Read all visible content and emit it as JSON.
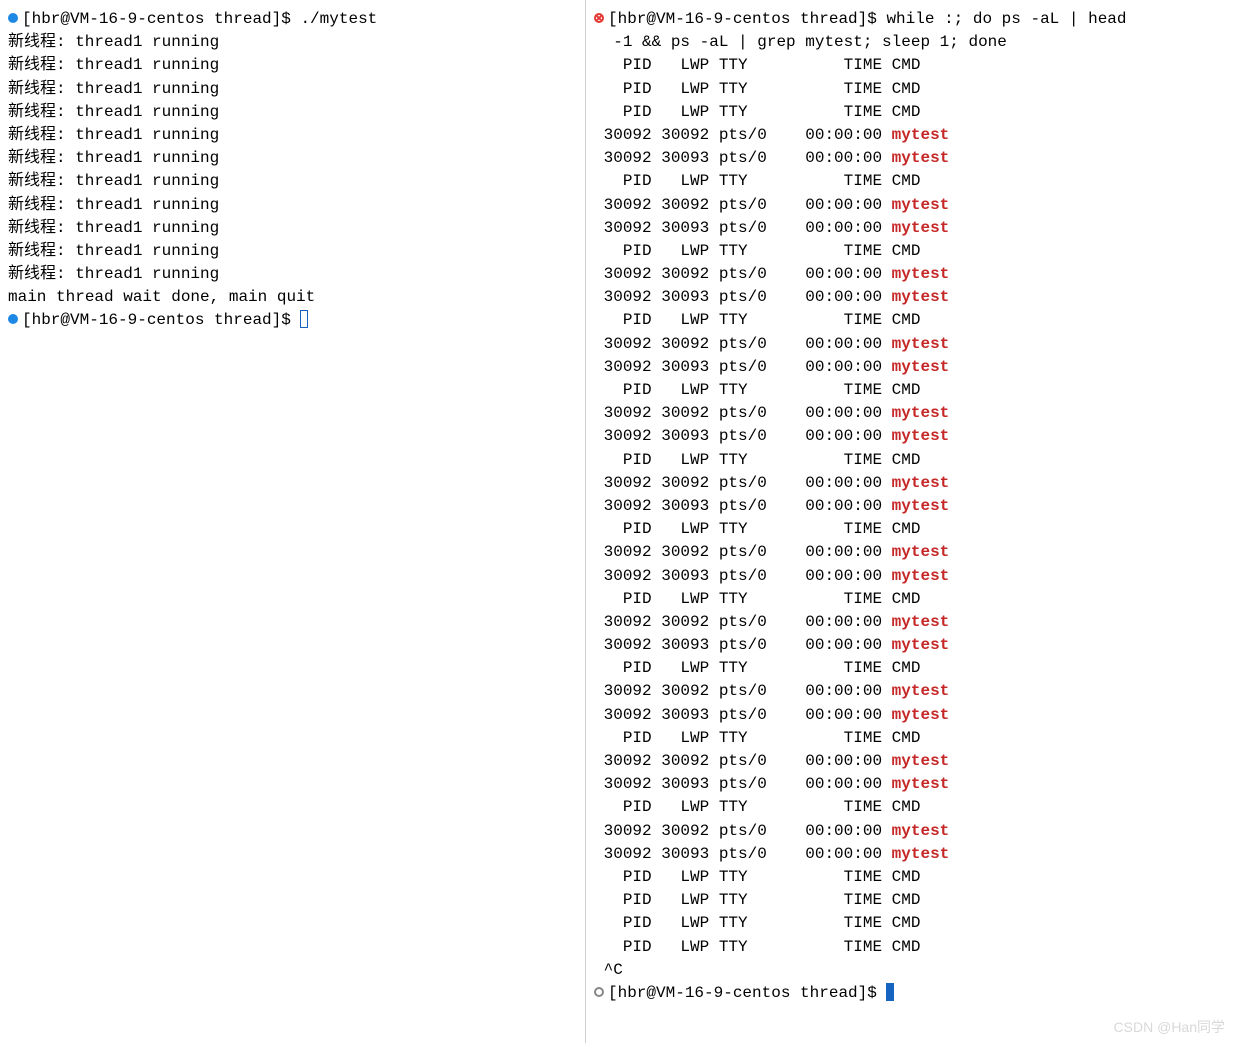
{
  "left": {
    "prompt": "[hbr@VM-16-9-centos thread]$ ",
    "command": "./mytest",
    "thread_line": "新线程: thread1 running",
    "thread_repeat": 11,
    "exit_line": "main thread wait done, main quit",
    "prompt2": "[hbr@VM-16-9-centos thread]$ "
  },
  "right": {
    "prompt": "[hbr@VM-16-9-centos thread]$ ",
    "command_l1": "while :; do ps -aL | head",
    "command_l2": " -1 && ps -aL | grep mytest; sleep 1; done",
    "header": "  PID   LWP TTY          TIME CMD",
    "row1": "30092 30092 pts/0    00:00:00 ",
    "row2": "30092 30093 pts/0    00:00:00 ",
    "match": "mytest",
    "pre_headers": 3,
    "cycles": 11,
    "post_headers": 4,
    "interrupt": "^C",
    "prompt2": "[hbr@VM-16-9-centos thread]$ "
  },
  "watermark": "CSDN @Han同学"
}
